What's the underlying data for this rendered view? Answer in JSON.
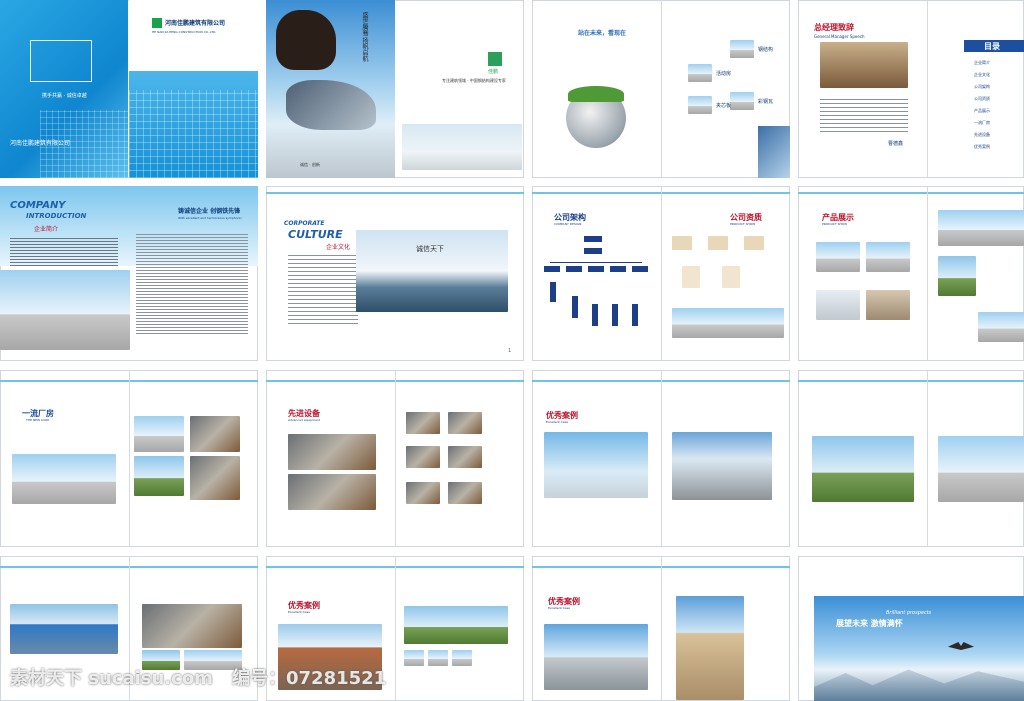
{
  "cover": {
    "company_cn": "河南佳鹏建筑有限公司",
    "company_en": "HE NAN JIA PENG CONSTRUCTION CO.,LTD.",
    "handbook": "携手共赢 · 诚信卓越",
    "footer_company": "河南佳鹏建筑有限公司",
    "calligraphy": "盛世腾骞 扬帆启航",
    "tagline": "专注建筑领域 · 中国钢结构建设专家",
    "bottom_note": "诚信 · 创新",
    "logo_text": "佳鹏"
  },
  "page_slogan": "站在未来，看现在",
  "products_small": [
    "钢结构",
    "活动房",
    "彩钢瓦",
    "夹芯板"
  ],
  "speech": {
    "title": "总经理致辞",
    "subtitle": "General Manager Speech",
    "signature": "曹德鑫"
  },
  "toc": {
    "title": "目录",
    "items": [
      "企业简介",
      "企业文化",
      "公司架构",
      "公司资质",
      "产品展示",
      "一流厂房",
      "先进设备",
      "优秀案例"
    ]
  },
  "intro": {
    "en1": "COMPANY",
    "en2": "INTRODUCTION",
    "cn": "企业简介",
    "slogan": "铸诚信企业 创钢铁先锋",
    "slogan_en": "With excellent and harmonious symphonic"
  },
  "culture": {
    "en1": "CORPORATE",
    "en2": "CULTURE",
    "cn": "企业文化",
    "calligraphy": "诚信天下"
  },
  "org": {
    "title": "公司架构",
    "en": "COMPANY DESIGN"
  },
  "qual": {
    "title": "公司资质",
    "en": "PRODUCT SHOW"
  },
  "products": {
    "title": "产品展示",
    "en": "PRODUCT SHOW"
  },
  "plant": {
    "title": "一流厂房",
    "en": "THE NEW LOOK"
  },
  "equip": {
    "title": "先进设备",
    "en": "Advanced equipment"
  },
  "cases": {
    "title": "优秀案例",
    "en": "Excellent Case"
  },
  "ending": {
    "calligraphy": "展望未来 激情满怀",
    "en": "Brilliant prospects"
  },
  "watermark": {
    "site": "素材天下 sucaisu.com",
    "id_label": "编号：07281521"
  }
}
